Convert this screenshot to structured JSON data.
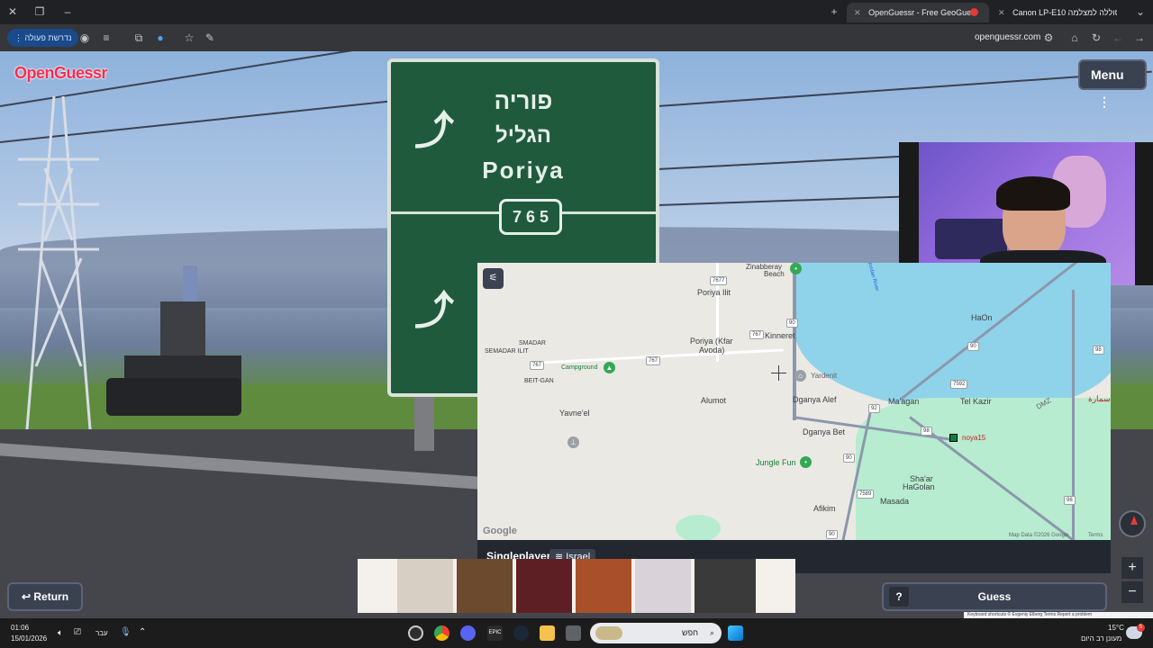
{
  "browser": {
    "tabs": [
      {
        "title": "OpenGuessr - Free GeoGue",
        "active": true
      },
      {
        "title": "Canon LP-E10 סוללה למצלמה",
        "active": false
      }
    ],
    "url": "openguessr.com",
    "action_pill": "נדרשת פעולה"
  },
  "game": {
    "logo": "OpenGuessr",
    "menu_label": "Menu",
    "return_label": "Return",
    "guess_label": "Guess",
    "help_label": "?",
    "mode_label": "Singleplayer",
    "country_label": "Israel",
    "sign": {
      "hebrew_top": "פוריה",
      "hebrew_mid": "הגליל",
      "latin": "Poriya",
      "route": "7 6 5"
    }
  },
  "map": {
    "labels": {
      "zinabberay": "Zinabberay",
      "beach": "Beach",
      "poriya_ilit": "Poriya Ilit",
      "kinneret": "Kinneret",
      "poriya_kfar": "Poriya (Kfar",
      "avoda": "Avoda)",
      "smadar": "SMADAR",
      "semadar_ilit": "SEMADAR ILIT",
      "campground": "Campground",
      "beit_gan": "BEIT-GAN",
      "yardenit": "Yardenit",
      "dganya_alef": "Dganya Alef",
      "alumot": "Alumot",
      "yavneel": "Yavne'el",
      "maagan": "Ma'agan",
      "tel_kazir": "Tel Kazir",
      "haon": "HaOn",
      "dganya_bet": "Dganya Bet",
      "noya15": "noya15",
      "jungle_fun": "Jungle Fun",
      "sharhagolan_1": "Sha'ar",
      "sharhagolan_2": "HaGolan",
      "masada": "Masada",
      "afikim": "Afikim",
      "dmz": "DMZ",
      "samra": "سمارة",
      "jordan_river": "Jordan River"
    },
    "shields": [
      "7677",
      "90",
      "767",
      "767",
      "90",
      "92",
      "98",
      "92",
      "90",
      "90",
      "98",
      "98",
      "7592",
      "98",
      "7589",
      "90",
      "98",
      "767"
    ],
    "google": "Google",
    "attribution": "Map Data ©2026 Google",
    "terms": "Terms",
    "footer": "Keyboard shortcuts   © Evgeniy Elberg   Terms   Report a problem"
  },
  "taskbar": {
    "time": "01:06",
    "date": "15/01/2026",
    "lang": "עבר",
    "search_placeholder": "חפש",
    "weather_temp": "15°C",
    "weather_desc": "מעונן רב היום",
    "notif_count": "5"
  }
}
